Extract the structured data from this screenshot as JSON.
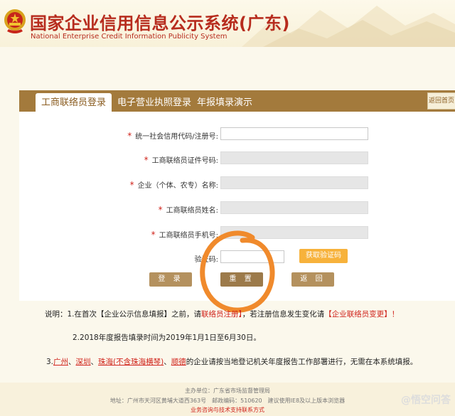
{
  "header": {
    "title": "国家企业信用信息公示系统(广东)",
    "subtitle": "National Enterprise Credit Information Publicity System"
  },
  "tabs": [
    {
      "label": "工商联络员登录",
      "active": true
    },
    {
      "label": "电子营业执照登录",
      "active": false
    },
    {
      "label": "年报填录演示",
      "active": false
    }
  ],
  "return_home": "返回首页",
  "form": {
    "fields": [
      {
        "label": "统一社会信用代码/注册号:",
        "required": true,
        "disabled": false,
        "value": ""
      },
      {
        "label": "工商联络员证件号码:",
        "required": true,
        "disabled": true,
        "value": ""
      },
      {
        "label": "企业（个体、农专）名称:",
        "required": true,
        "disabled": true,
        "value": ""
      },
      {
        "label": "工商联络员姓名:",
        "required": true,
        "disabled": true,
        "value": ""
      },
      {
        "label": "工商联络员手机号:",
        "required": true,
        "disabled": true,
        "value": ""
      }
    ],
    "captcha_label": "验证码:",
    "captcha_button": "获取验证码",
    "buttons": {
      "login": "登 录",
      "reset": "重 置",
      "back": "返 回"
    }
  },
  "notes": {
    "n1_prefix": "说明：1.在首次【企业公示信息填报】之前，请",
    "n1_link1": "联络员注册】",
    "n1_mid": "，若注册信息发生变化请",
    "n1_link2": "【企业联络员变更】",
    "n1_end": "！",
    "n2": "2.2018年度报告填录时间为2019年1月1日至6月30日。",
    "n3_prefix": "3.",
    "n3_cities": [
      "广州",
      "深圳",
      "珠海(不含珠海横琴)",
      "顺德"
    ],
    "n3_sep": "、",
    "n3_suffix": "的企业请按当地登记机关年度报告工作部署进行，无需在本系统填报。"
  },
  "footer": {
    "sponsor": "主办单位：广东省市场监督管理局",
    "address": "地址：广州市天河区黄埔大道西363号　邮政编码：510620　建议使用IE8及以上版本浏览器",
    "support": "业务咨询与技术支持联系方式"
  },
  "watermark": "@悟空问答",
  "colors": {
    "brand_red": "#b72c1e",
    "tab_brown": "#a37a3c",
    "captcha_orange": "#f7b23b",
    "annotation_orange": "#f08a2c"
  }
}
